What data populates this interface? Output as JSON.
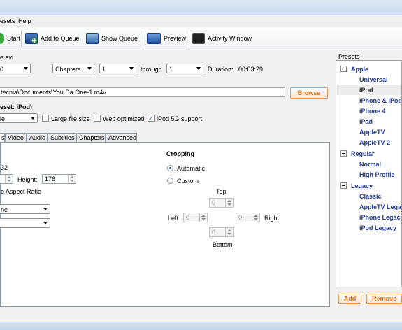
{
  "menu": {
    "presets": "esets",
    "help": "Help"
  },
  "toolbar": {
    "start": "Start",
    "add_to_queue": "Add to Queue",
    "show_queue": "Show Queue",
    "preview": "Preview",
    "activity_window": "Activity Window"
  },
  "source": {
    "file_label": "e.avi",
    "title_value": "0",
    "chapters_mode": "Chapters",
    "chapter_start": "1",
    "through": "through",
    "chapter_end": "1",
    "duration_label": "Duration:",
    "duration_value": "00:03:29"
  },
  "destination": {
    "path": "tecnia\\Documents\\You Da One-1.m4v",
    "browse": "Browse"
  },
  "output": {
    "preset_label": "eset: iPod)",
    "container": "le",
    "large_file_size": "Large file size",
    "web_optimized": "Web optimized",
    "ipod_5g": "iPod 5G support"
  },
  "tabs": [
    "s",
    "Video",
    "Audio",
    "Subtitles",
    "Chapters",
    "Advanced"
  ],
  "picture": {
    "width_partial": "32",
    "height_label": "Height:",
    "height_value": "176",
    "aspect_label": "o Aspect Ratio",
    "anamorphic": "ne",
    "modulus": "",
    "cropping_title": "Cropping",
    "automatic": "Automatic",
    "custom": "Custom",
    "top": "Top",
    "left": "Left",
    "right": "Right",
    "bottom": "Bottom",
    "crop_top": "0",
    "crop_left": "0",
    "crop_right": "0",
    "crop_bottom": "0"
  },
  "presets_panel": {
    "title": "Presets",
    "groups": [
      {
        "name": "Apple",
        "items": [
          "Universal",
          "iPod",
          "iPhone & iPod",
          "iPhone 4",
          "iPad",
          "AppleTV",
          "AppleTV 2"
        ]
      },
      {
        "name": "Regular",
        "items": [
          "Normal",
          "High Profile"
        ]
      },
      {
        "name": "Legacy",
        "items": [
          "Classic",
          "AppleTV Legacy",
          "iPhone Legacy",
          "iPod Legacy"
        ]
      }
    ],
    "selected": "iPod",
    "add": "Add",
    "remove": "Remove"
  },
  "colors": {
    "preset_text": "#1f3a9e",
    "accent_orange": "#e07318"
  }
}
